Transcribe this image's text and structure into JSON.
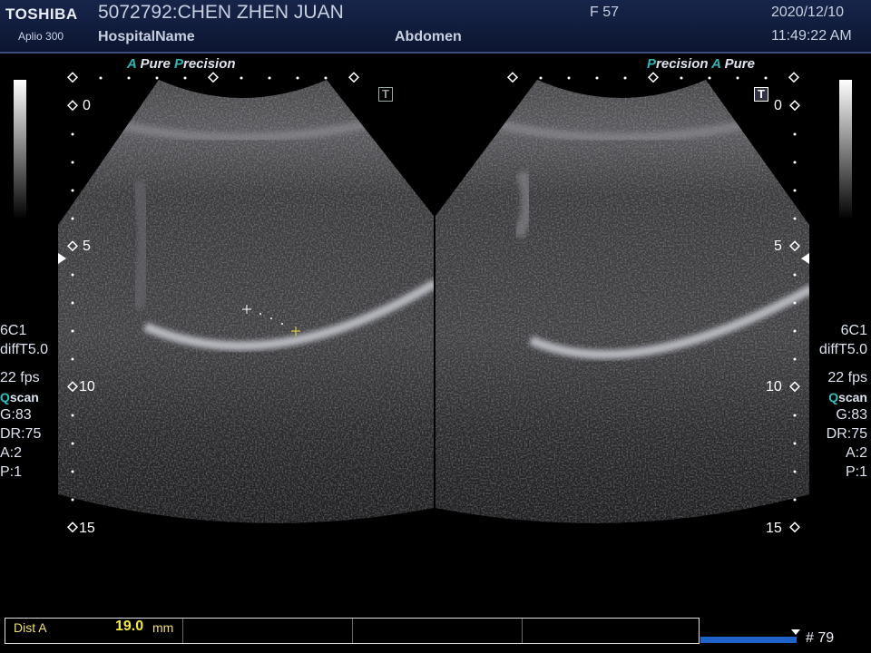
{
  "header": {
    "brand": "TOSHIBA",
    "model": "Aplio 300",
    "patient": "5072792:CHEN ZHEN JUAN",
    "hospital": "HospitalName",
    "sex_age": "F  57",
    "study": "Abdomen",
    "date": "2020/12/10",
    "time": "11:49:22 AM"
  },
  "tags": {
    "a_letter": "A",
    "pure": "Pure",
    "p_letter": "P",
    "recision": "recision",
    "precision_full": "Precision"
  },
  "left_params": {
    "probe": "6C1",
    "filter": "diffT5.0",
    "fps": "22 fps",
    "q": "Q",
    "scan": "scan",
    "gain": "G:83",
    "dr": "DR:75",
    "a": "A:2",
    "p": "P:1"
  },
  "right_params": {
    "probe": "6C1",
    "filter": "diffT5.0",
    "fps": "22 fps",
    "q": "Q",
    "scan": "scan",
    "gain": "G:83",
    "dr": "DR:75",
    "a": "A:2",
    "p": "P:1"
  },
  "depth_labels": [
    "0",
    "5",
    "10",
    "15"
  ],
  "t_marker": "T",
  "measurement": {
    "label": "Dist A",
    "value": "19.0",
    "unit": "mm"
  },
  "frame_number": "# 79"
}
